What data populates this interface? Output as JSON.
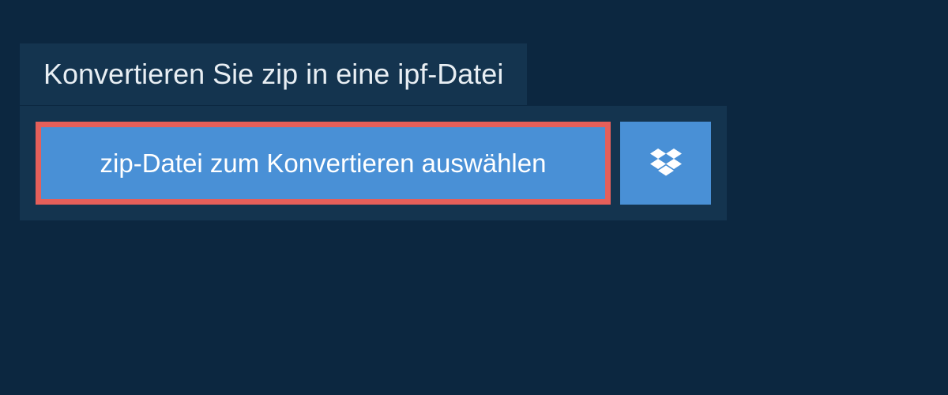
{
  "header": {
    "title": "Konvertieren Sie zip in eine ipf-Datei"
  },
  "actions": {
    "select_file_label": "zip-Datei zum Konvertieren auswählen"
  },
  "colors": {
    "background": "#0c2740",
    "panel": "#14344f",
    "button_primary": "#4990d6",
    "highlight_border": "#e55f5a"
  }
}
